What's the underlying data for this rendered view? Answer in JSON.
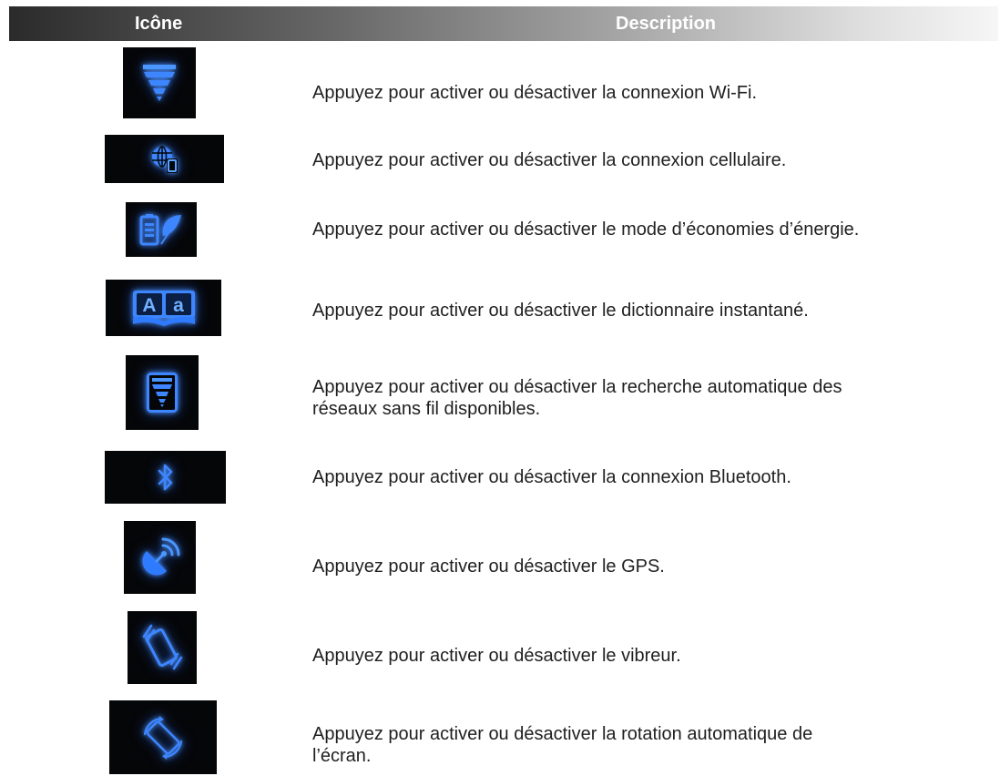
{
  "table": {
    "header": {
      "icon_col": "Icône",
      "description_col": "Description"
    },
    "colors": {
      "icon_background": "#050608",
      "icon_blue": "#2f7bff",
      "icon_blue_light": "#6fb0ff"
    },
    "rows": [
      {
        "icon": "wifi-icon",
        "lines": [
          "Appuyez pour activer ou désactiver la connexion Wi-Fi."
        ]
      },
      {
        "icon": "cellular-icon",
        "lines": [
          "Appuyez pour activer ou désactiver la connexion cellulaire."
        ]
      },
      {
        "icon": "power-saving-icon",
        "lines": [
          "Appuyez pour activer ou désactiver le mode d’économies d’énergie."
        ]
      },
      {
        "icon": "dictionary-icon",
        "lines": [
          "Appuyez pour activer ou désactiver le dictionnaire instantané."
        ]
      },
      {
        "icon": "network-scan-icon",
        "lines": [
          "Appuyez pour activer ou désactiver la recherche automatique des",
          "réseaux sans fil disponibles."
        ]
      },
      {
        "icon": "bluetooth-icon",
        "lines": [
          "Appuyez pour activer ou désactiver la connexion Bluetooth."
        ]
      },
      {
        "icon": "gps-icon",
        "lines": [
          "Appuyez pour activer ou désactiver le GPS."
        ]
      },
      {
        "icon": "vibrate-icon",
        "lines": [
          "Appuyez pour activer ou désactiver le vibreur."
        ]
      },
      {
        "icon": "auto-rotate-icon",
        "lines": [
          "Appuyez pour activer ou désactiver la rotation automatique de",
          "l’écran."
        ]
      }
    ]
  }
}
